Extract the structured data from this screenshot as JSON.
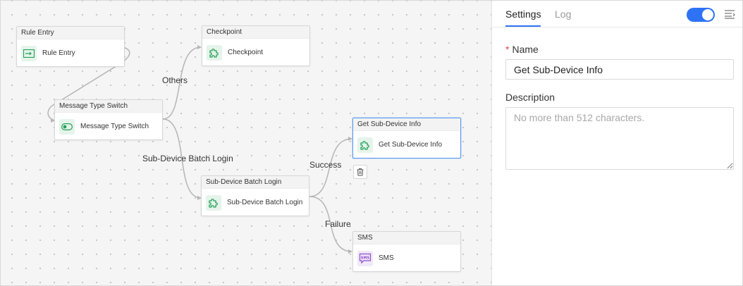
{
  "canvas": {
    "nodes": [
      {
        "id": "rule-entry",
        "title": "Rule Entry",
        "label": "Rule Entry",
        "icon": "rule-entry-icon"
      },
      {
        "id": "checkpoint",
        "title": "Checkpoint",
        "label": "Checkpoint",
        "icon": "puzzle-icon"
      },
      {
        "id": "message-type-switch",
        "title": "Message Type Switch",
        "label": "Message Type Switch",
        "icon": "switch-icon"
      },
      {
        "id": "get-sub-device-info",
        "title": "Get Sub-Device Info",
        "label": "Get Sub-Device Info",
        "icon": "puzzle-icon",
        "selected": true
      },
      {
        "id": "sub-device-batch-login",
        "title": "Sub-Device Batch Login",
        "label": "Sub-Device Batch Login",
        "icon": "puzzle-icon"
      },
      {
        "id": "sms",
        "title": "SMS",
        "label": "SMS",
        "icon": "sms-icon"
      }
    ],
    "edge_labels": {
      "others": "Others",
      "batch_login": "Sub-Device Batch Login",
      "success": "Success",
      "failure": "Failure"
    },
    "edges": [
      {
        "from": "rule-entry",
        "to": "message-type-switch"
      },
      {
        "from": "message-type-switch",
        "to": "checkpoint",
        "label": "Others"
      },
      {
        "from": "message-type-switch",
        "to": "sub-device-batch-login",
        "label": "Sub-Device Batch Login"
      },
      {
        "from": "sub-device-batch-login",
        "to": "get-sub-device-info",
        "label": "Success"
      },
      {
        "from": "sub-device-batch-login",
        "to": "sms",
        "label": "Failure"
      }
    ],
    "delete_icon": "trash-icon"
  },
  "panel": {
    "tabs": [
      {
        "label": "Settings",
        "active": true
      },
      {
        "label": "Log",
        "active": false
      }
    ],
    "toggle_on": true,
    "name_label": "Name",
    "required_mark": "*",
    "name_value": "Get Sub-Device Info",
    "description_label": "Description",
    "description_placeholder": "No more than 512 characters.",
    "accent_color": "#2e73f5"
  }
}
